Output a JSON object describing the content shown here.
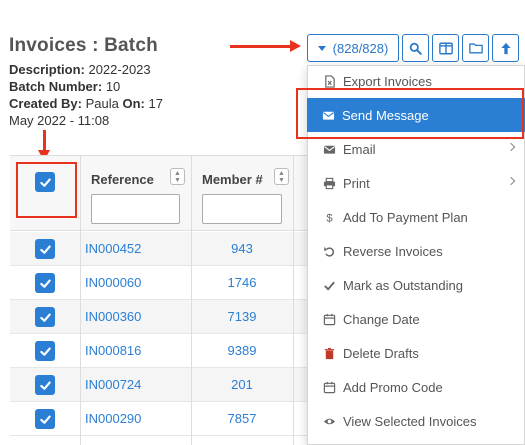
{
  "header": {
    "title": "Invoices : Batch",
    "description_label": "Description:",
    "description_value": "2022-2023",
    "batch_label": "Batch Number:",
    "batch_value": "10",
    "created_by_label": "Created By:",
    "created_by_value": "Paula",
    "on_label": "On:",
    "on_value_1": "17",
    "on_value_2": "May 2022 - 11:08"
  },
  "toolbar": {
    "count_label": "(828/828)",
    "icons": [
      "search-icon",
      "columns-icon",
      "folder-icon",
      "arrow-up-icon"
    ]
  },
  "table": {
    "columns": [
      "Reference",
      "Member #"
    ],
    "rows": [
      {
        "reference": "IN000452",
        "member": "943"
      },
      {
        "reference": "IN000060",
        "member": "1746"
      },
      {
        "reference": "IN000360",
        "member": "7139"
      },
      {
        "reference": "IN000816",
        "member": "9389"
      },
      {
        "reference": "IN000724",
        "member": "201"
      },
      {
        "reference": "IN000290",
        "member": "7857"
      }
    ]
  },
  "menu": {
    "items": [
      {
        "label": "Export Invoices",
        "icon": "file-excel-icon"
      },
      {
        "label": "Send Message",
        "icon": "envelope-icon",
        "active": true
      },
      {
        "label": "Email",
        "icon": "envelope-icon",
        "submenu": true
      },
      {
        "label": "Print",
        "icon": "printer-icon",
        "submenu": true
      },
      {
        "label": "Add To Payment Plan",
        "icon": "dollar-icon"
      },
      {
        "label": "Reverse Invoices",
        "icon": "undo-icon"
      },
      {
        "label": "Mark as Outstanding",
        "icon": "check-icon"
      },
      {
        "label": "Change Date",
        "icon": "calendar-icon"
      },
      {
        "label": "Delete Drafts",
        "icon": "trash-icon"
      },
      {
        "label": "Add Promo Code",
        "icon": "calendar-icon"
      },
      {
        "label": "View Selected Invoices",
        "icon": "eye-icon"
      }
    ]
  },
  "colors": {
    "accent": "#2a7fd4",
    "highlight": "#e8321d",
    "delete_icon": "#c0392b"
  }
}
